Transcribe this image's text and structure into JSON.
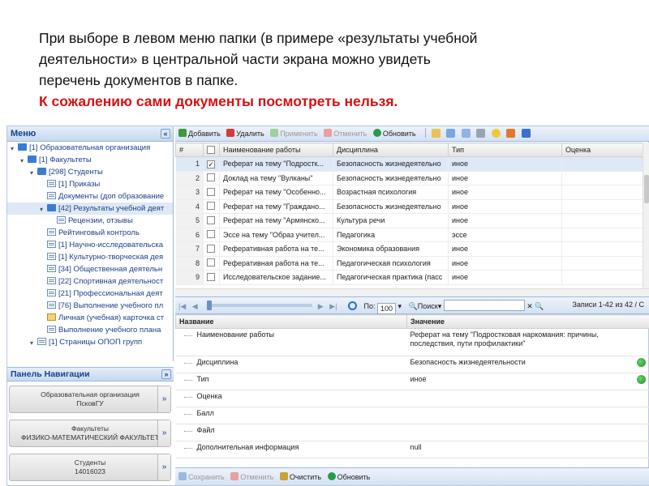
{
  "caption": {
    "line1": "При выборе в левом меню папки (в примере «результаты учебной",
    "line2": "деятельности» в центральной части экрана можно увидеть",
    "line3": "перечень документов в папке.",
    "warning": "К сожалению сами документы посмотреть нельзя."
  },
  "menu": {
    "title": "Меню",
    "items": [
      {
        "label": "[1] Образовательная организация",
        "indent": 0,
        "icon": "folder-icon"
      },
      {
        "label": "[1] Факультеты",
        "indent": 1,
        "icon": "folder-icon"
      },
      {
        "label": "[298] Студенты",
        "indent": 2,
        "icon": "folder-icon"
      },
      {
        "label": "[1] Приказы",
        "indent": 3,
        "icon": "doc-icon"
      },
      {
        "label": "Документы (доп образование",
        "indent": 3,
        "icon": "doc-icon"
      },
      {
        "label": "[42] Результаты учебной деят",
        "indent": 3,
        "icon": "folder-icon",
        "selected": true
      },
      {
        "label": "Рецензии, отзывы",
        "indent": 4,
        "icon": "doc-icon"
      },
      {
        "label": "Рейтинговый контроль",
        "indent": 3,
        "icon": "doc-icon"
      },
      {
        "label": "[1] Научно-исследовательска",
        "indent": 3,
        "icon": "doc-icon"
      },
      {
        "label": "[1] Культурно-творческая дея",
        "indent": 3,
        "icon": "doc-icon"
      },
      {
        "label": "[34] Общественная деятельн",
        "indent": 3,
        "icon": "doc-icon"
      },
      {
        "label": "[22] Спортивная деятельност",
        "indent": 3,
        "icon": "doc-icon"
      },
      {
        "label": "[21] Профессиональная деят",
        "indent": 3,
        "icon": "doc-icon"
      },
      {
        "label": "[76] Выполнение учебного пл",
        "indent": 3,
        "icon": "doc-icon"
      },
      {
        "label": "Личная (учебная) карточка ст",
        "indent": 3,
        "icon": "card-icon"
      },
      {
        "label": "Выполнение учебного плана",
        "indent": 3,
        "icon": "doc-icon"
      },
      {
        "label": "[1] Страницы ОПОП групп",
        "indent": 2,
        "icon": "doc-icon"
      }
    ]
  },
  "nav_panel": {
    "title": "Панель Навигации",
    "buttons": [
      {
        "line1": "Образовательная организация",
        "line2": "ПсковГУ",
        "arrow": "»"
      },
      {
        "line1": "Факультеты",
        "line2": "ФИЗИКО-МАТЕМАТИЧЕСКИЙ ФАКУЛЬТЕТ",
        "arrow": "»"
      },
      {
        "line1": "Студенты",
        "line2": "14016023",
        "arrow": "»"
      }
    ]
  },
  "toolbar": {
    "add": "Добавить",
    "delete": "Удалить",
    "apply": "Применить",
    "cancel": "Отменить",
    "refresh": "Обновить"
  },
  "grid": {
    "columns": [
      "#",
      "",
      "Наименование работы",
      "Дисциплина",
      "Тип",
      "Оценка"
    ],
    "rows": [
      {
        "n": "1",
        "checked": true,
        "name": "Реферат на тему \"Подростк...",
        "discipline": "Безопасность жизнедеятельно",
        "type": "иное",
        "grade": ""
      },
      {
        "n": "2",
        "checked": false,
        "name": "Доклад на тему \"Вулканы\"",
        "discipline": "Безопасность жизнедеятельно",
        "type": "иное",
        "grade": ""
      },
      {
        "n": "3",
        "checked": false,
        "name": "Реферат на тему \"Особенно...",
        "discipline": "Возрастная психология",
        "type": "иное",
        "grade": ""
      },
      {
        "n": "4",
        "checked": false,
        "name": "Реферат на тему \"Граждано...",
        "discipline": "Безопасность жизнедеятельно",
        "type": "иное",
        "grade": ""
      },
      {
        "n": "5",
        "checked": false,
        "name": "Реферат на тему \"Армянско...",
        "discipline": "Культура речи",
        "type": "иное",
        "grade": ""
      },
      {
        "n": "6",
        "checked": false,
        "name": "Эссе на тему \"Образ учител...",
        "discipline": "Педагогика",
        "type": "эссе",
        "grade": ""
      },
      {
        "n": "7",
        "checked": false,
        "name": "Реферативная работа на те...",
        "discipline": "Экономика образования",
        "type": "иное",
        "grade": ""
      },
      {
        "n": "8",
        "checked": false,
        "name": "Реферативная работа на те...",
        "discipline": "Педагогическая психология",
        "type": "иное",
        "grade": ""
      },
      {
        "n": "9",
        "checked": false,
        "name": "Исследовательское задание...",
        "discipline": "Педагогическая практика (пасс",
        "type": "иное",
        "grade": ""
      }
    ]
  },
  "pager": {
    "page_label": "По:",
    "page_size": "100",
    "search": "Поиск",
    "records": "Записи 1-42 из 42 / С"
  },
  "props": {
    "col_name": "Название",
    "col_value": "Значение",
    "rows": [
      {
        "name": "Наименование работы",
        "value": "Реферат на тему \"Подростковая наркомания: причины, последствия, пути профилактики\"",
        "action": false
      },
      {
        "name": "Дисциплина",
        "value": "Безопасность жизнедеятельности",
        "action": true
      },
      {
        "name": "Тип",
        "value": "иное",
        "action": true
      },
      {
        "name": "Оценка",
        "value": "",
        "action": false
      },
      {
        "name": "Балл",
        "value": "",
        "action": false
      },
      {
        "name": "Файл",
        "value": "",
        "action": false
      },
      {
        "name": "Дополнительная информация",
        "value": "null",
        "action": false
      }
    ]
  },
  "bottom_bar": {
    "save": "Сохранить",
    "cancel": "Отменить",
    "clear": "Очистить",
    "refresh": "Обновить"
  },
  "colors": {
    "warning": "#d81010",
    "panel_title": "#15428b",
    "selected_row": "#dfe8f6"
  }
}
